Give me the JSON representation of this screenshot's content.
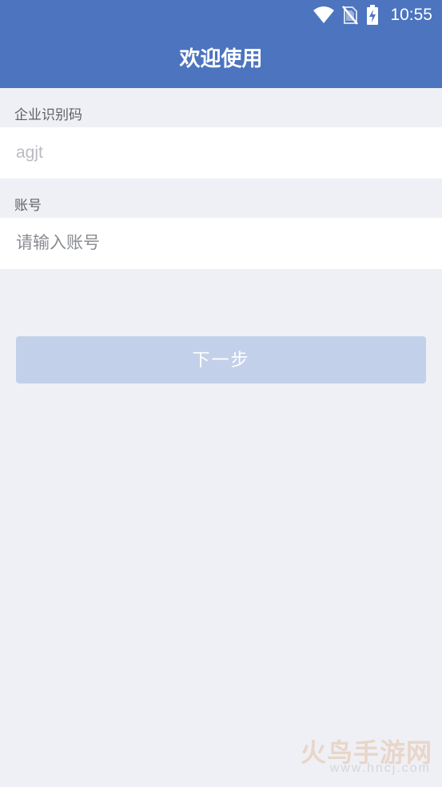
{
  "status_bar": {
    "time": "10:55",
    "icons": [
      "wifi-icon",
      "no-sim-icon",
      "battery-charging-icon"
    ]
  },
  "header": {
    "title": "欢迎使用",
    "background_color": "#4c74bf"
  },
  "form": {
    "company_code": {
      "label": "企业识别码",
      "value": "",
      "placeholder": "agjt"
    },
    "account": {
      "label": "账号",
      "value": "",
      "placeholder": "请输入账号"
    }
  },
  "next_button": {
    "label": "下一步",
    "state": "disabled",
    "color": "#c3d0e9"
  },
  "watermark": {
    "brand": "火鸟手游网",
    "url": "www.hncj.com"
  }
}
